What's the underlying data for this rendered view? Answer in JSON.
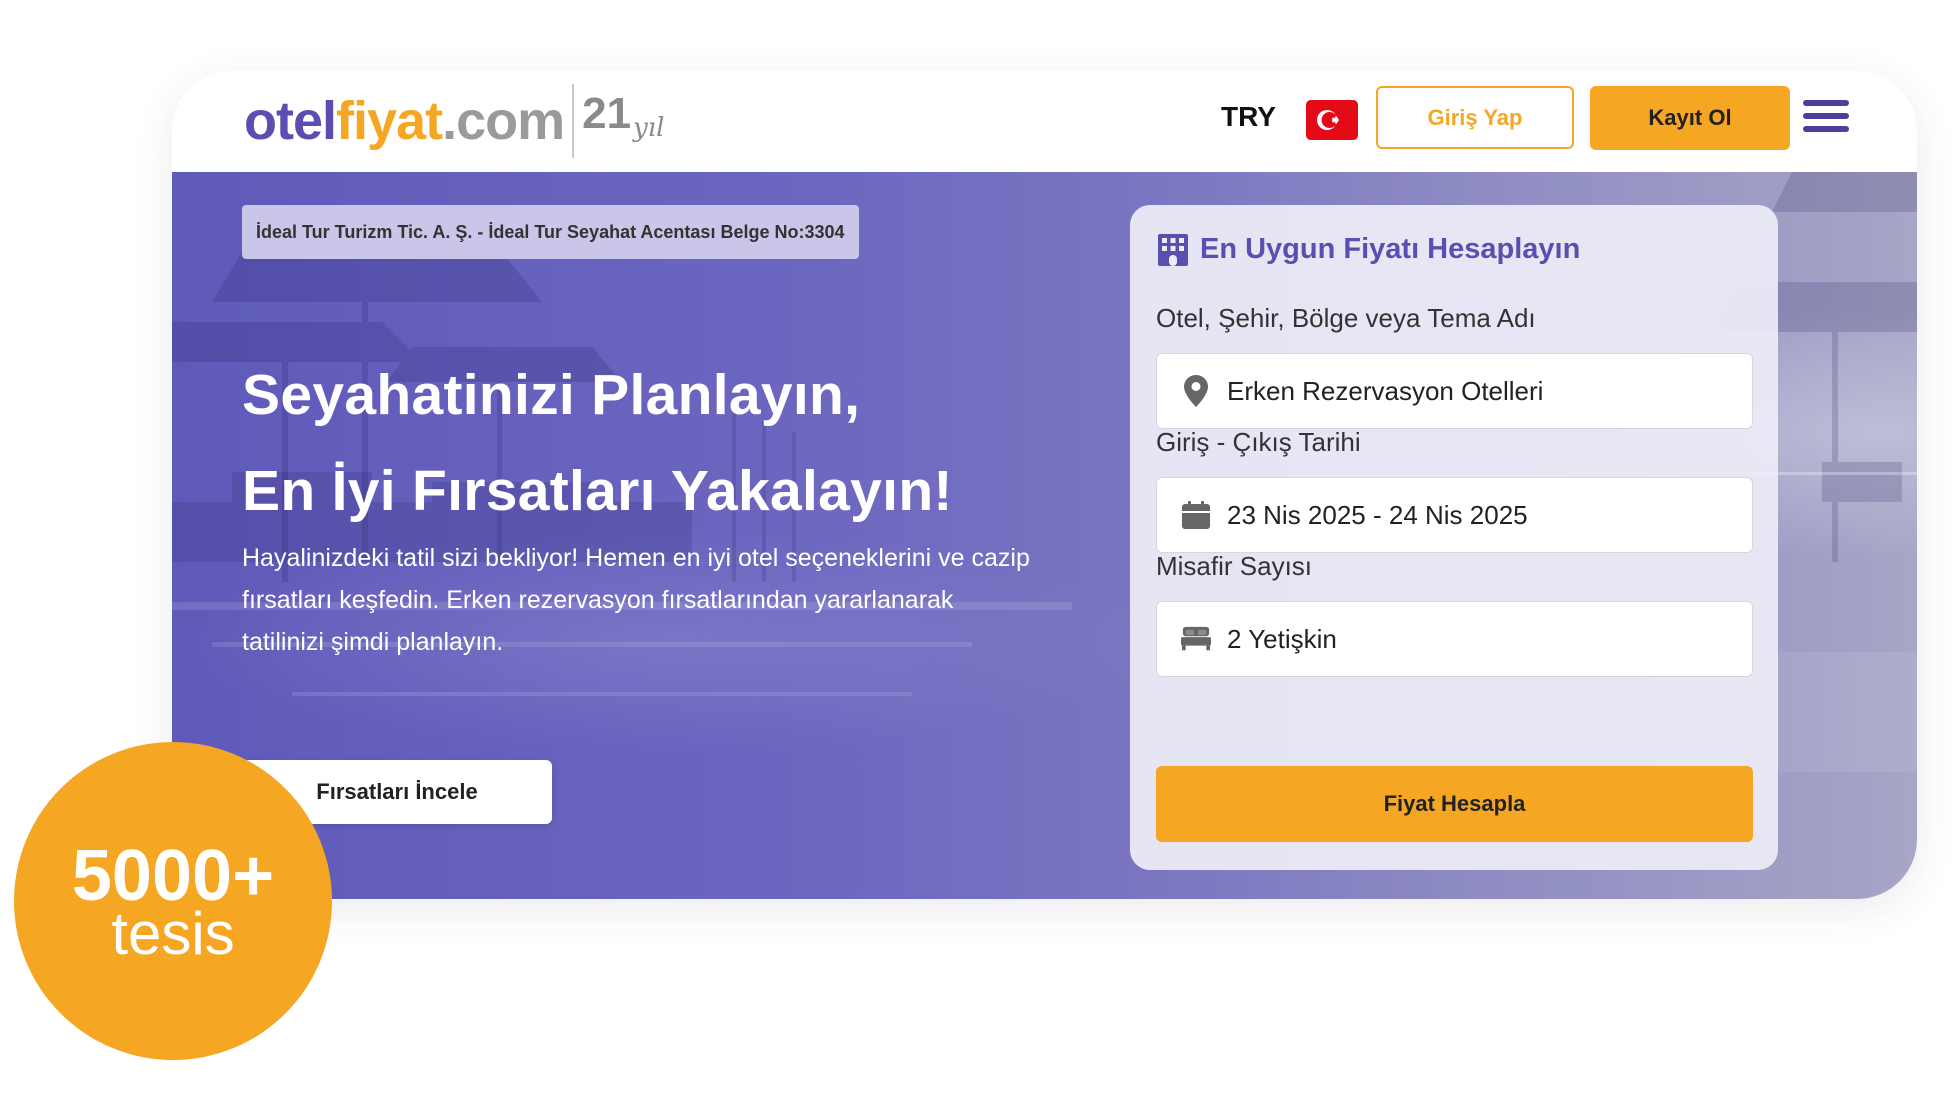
{
  "header": {
    "logo": {
      "otel": "otel",
      "fiyat": "fiyat",
      "com": ".com",
      "years": "21",
      "yil": "yıl"
    },
    "currency": "TRY",
    "flag": "turkey-flag",
    "login_label": "Giriş Yap",
    "register_label": "Kayıt Ol",
    "menu_icon": "hamburger-menu-icon"
  },
  "hero": {
    "license": "İdeal Tur Turizm Tic. A. Ş. - İdeal Tur Seyahat Acentası Belge No:3304",
    "title_line1": "Seyahatinizi Planlayın,",
    "title_line2": "En İyi Fırsatları Yakalayın!",
    "description": "Hayalinizdeki tatil sizi bekliyor! Hemen en iyi otel seçeneklerini ve cazip fırsatları keşfedin. Erken rezervasyon fırsatlarından yararlanarak tatilinizi şimdi planlayın.",
    "explore_label": "Fırsatları İncele"
  },
  "form": {
    "title": "En Uygun Fiyatı Hesaplayın",
    "title_icon": "hotel-building-icon",
    "destination_label": "Otel, Şehir, Bölge veya Tema Adı",
    "destination_value": "Erken Rezervasyon Otelleri",
    "dates_label": "Giriş - Çıkış Tarihi",
    "dates_value": "23 Nis 2025 - 24 Nis 2025",
    "guests_label": "Misafir Sayısı",
    "guests_value": "2 Yetişkin",
    "submit_label": "Fiyat Hesapla"
  },
  "badge": {
    "count": "5000+",
    "text": "tesis"
  },
  "colors": {
    "brand_purple": "#5a4fb0",
    "brand_orange": "#f5a623",
    "flag_red": "#e30a17"
  }
}
